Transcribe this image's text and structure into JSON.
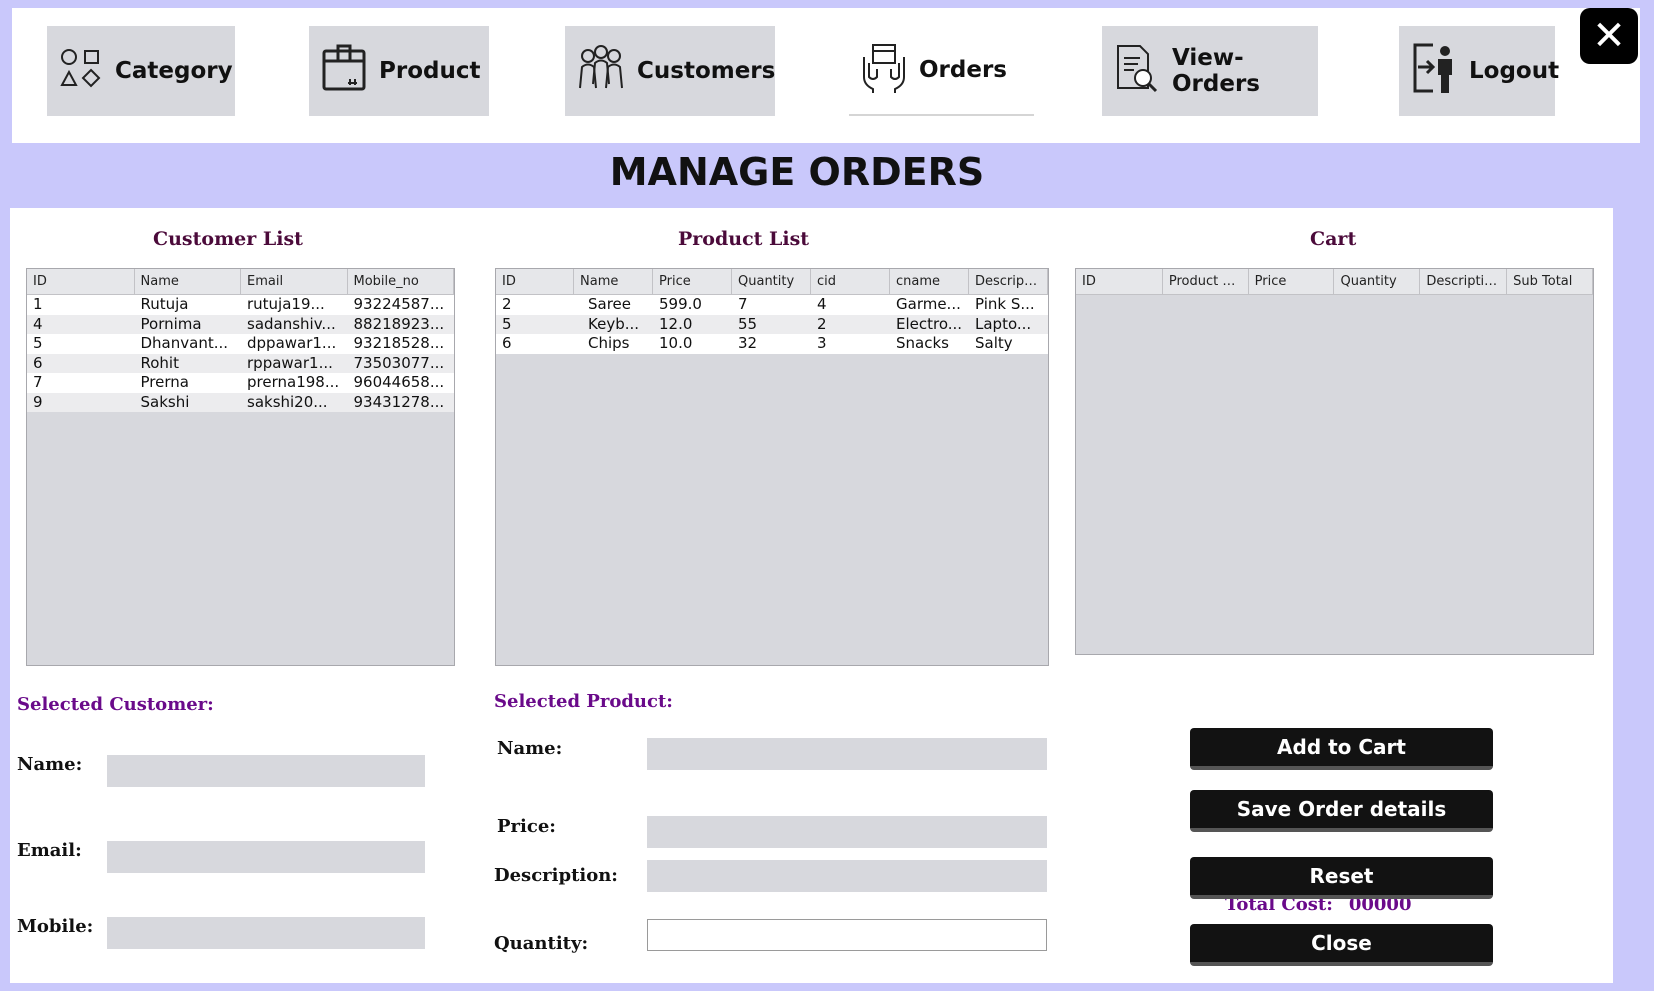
{
  "nav": {
    "category": "Category",
    "product": "Product",
    "customers": "Customers",
    "orders": "Orders",
    "view_orders": "View-Orders",
    "logout": "Logout",
    "close_glyph": "✕"
  },
  "page_title": "MANAGE ORDERS",
  "customer_list": {
    "title": "Customer List",
    "columns": [
      "ID",
      "Name",
      "Email",
      "Mobile_no"
    ],
    "rows": [
      [
        "1",
        "Rutuja",
        "rutuja19...",
        "93224587..."
      ],
      [
        "4",
        "Pornima",
        "sadanshiv...",
        "88218923..."
      ],
      [
        "5",
        "Dhanvant...",
        "dppawar1...",
        "93218528..."
      ],
      [
        "6",
        "Rohit",
        "rppawar1...",
        "73503077..."
      ],
      [
        "7",
        "Prerna",
        "prerna198...",
        "96044658..."
      ],
      [
        "9",
        "Sakshi",
        "sakshi20...",
        "93431278..."
      ]
    ]
  },
  "product_list": {
    "title": "Product List",
    "columns": [
      "ID",
      "Name",
      "Price",
      "Quantity",
      "cid",
      "cname",
      "Descripti..."
    ],
    "rows": [
      [
        "2",
        "Saree",
        "599.0",
        "7",
        "4",
        "Garme...",
        "Pink S..."
      ],
      [
        "5",
        "Keyb...",
        "12.0",
        "55",
        "2",
        "Electro...",
        "Lapto..."
      ],
      [
        "6",
        "Chips",
        "10.0",
        "32",
        "3",
        "Snacks",
        "Salty"
      ]
    ]
  },
  "cart": {
    "title": "Cart",
    "columns": [
      "ID",
      "Product N...",
      "Price",
      "Quantity",
      "Description",
      "Sub Total"
    ],
    "rows": []
  },
  "selected_customer": {
    "heading": "Selected Customer:",
    "name_label": "Name:",
    "email_label": "Email:",
    "mobile_label": "Mobile:",
    "name_value": "",
    "email_value": "",
    "mobile_value": ""
  },
  "selected_product": {
    "heading": "Selected Product:",
    "name_label": "Name:",
    "price_label": "Price:",
    "description_label": "Description:",
    "quantity_label": "Quantity:",
    "name_value": "",
    "price_value": "",
    "description_value": "",
    "quantity_value": ""
  },
  "total": {
    "label": "Total Cost:",
    "value": "00000"
  },
  "buttons": {
    "add_to_cart": "Add to Cart",
    "save_order": "Save Order details",
    "reset": "Reset",
    "close": "Close"
  }
}
